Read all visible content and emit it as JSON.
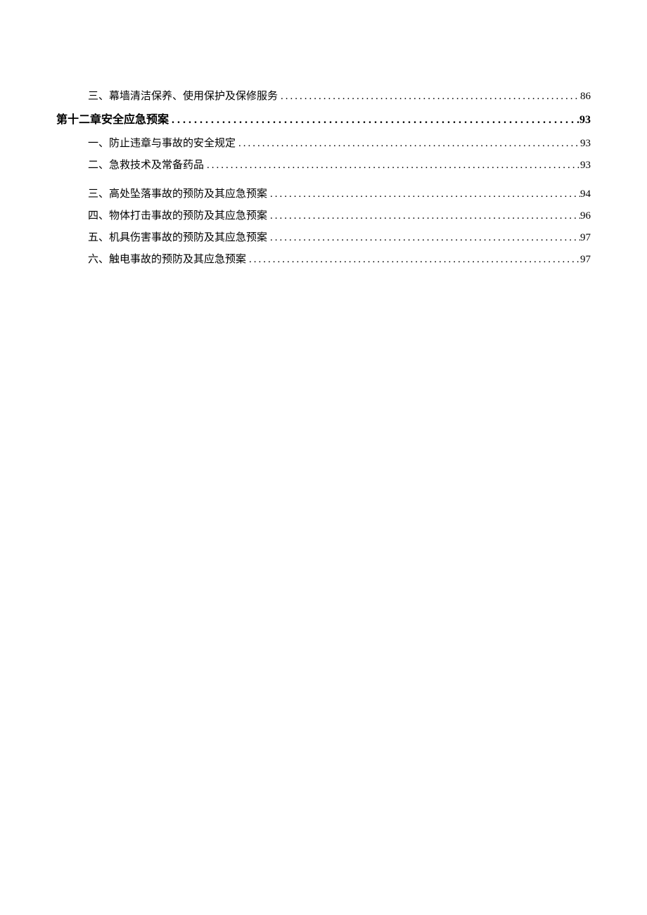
{
  "toc": {
    "items": [
      {
        "title": "三、幕墙清洁保养、使用保护及保修服务",
        "page": "86",
        "level": "sub"
      },
      {
        "title": "第十二章安全应急预案",
        "page": "93",
        "level": "chapter"
      },
      {
        "title": "一、防止违章与事故的安全规定",
        "page": "93",
        "level": "sub"
      },
      {
        "title": "二、急救技术及常备药品",
        "page": "93",
        "level": "sub",
        "gapAfter": true
      },
      {
        "title": "三、高处坠落事故的预防及其应急预案",
        "page": "94",
        "level": "sub"
      },
      {
        "title": "四、物体打击事故的预防及其应急预案",
        "page": "96",
        "level": "sub"
      },
      {
        "title": "五、机具伤害事故的预防及其应急预案",
        "page": "97",
        "level": "sub"
      },
      {
        "title": "六、触电事故的预防及其应急预案",
        "page": "97",
        "level": "sub"
      }
    ]
  }
}
